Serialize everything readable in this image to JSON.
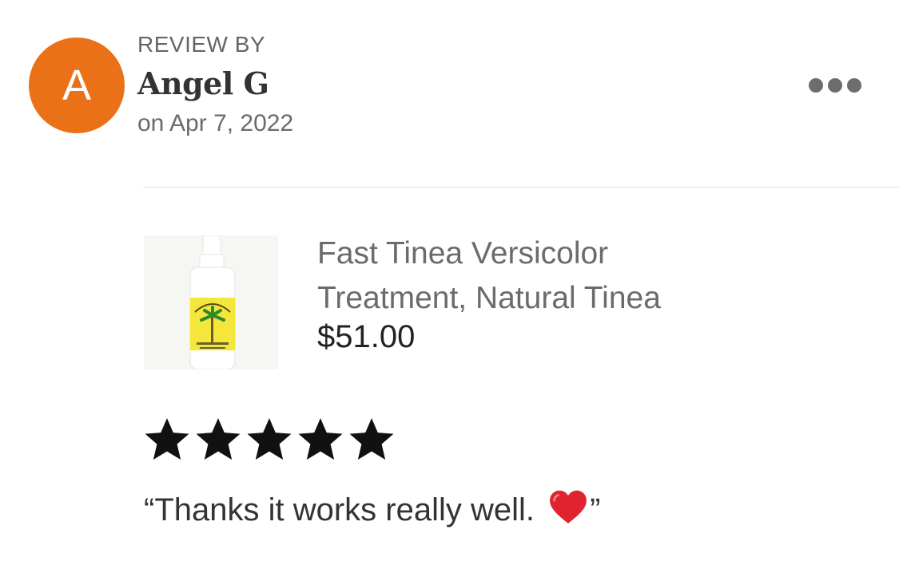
{
  "review": {
    "heading": "REVIEW BY",
    "reviewer_initial": "A",
    "reviewer_name": "Angel G",
    "date": "on Apr 7, 2022",
    "avatar_color": "#ea7118",
    "more_icon": "more-horizontal-icon"
  },
  "product": {
    "title_line1": "Fast Tinea Versicolor",
    "title_line2": "Treatment, Natural Tinea",
    "price": "$51.00",
    "image_label": "Jungle Rot Spray"
  },
  "rating": {
    "value": 5,
    "max": 5,
    "star_color": "#111111"
  },
  "review_body": {
    "open_quote": "“",
    "text": "Thanks it works really well. ",
    "emoji": "heart-icon",
    "close_quote": "”"
  }
}
